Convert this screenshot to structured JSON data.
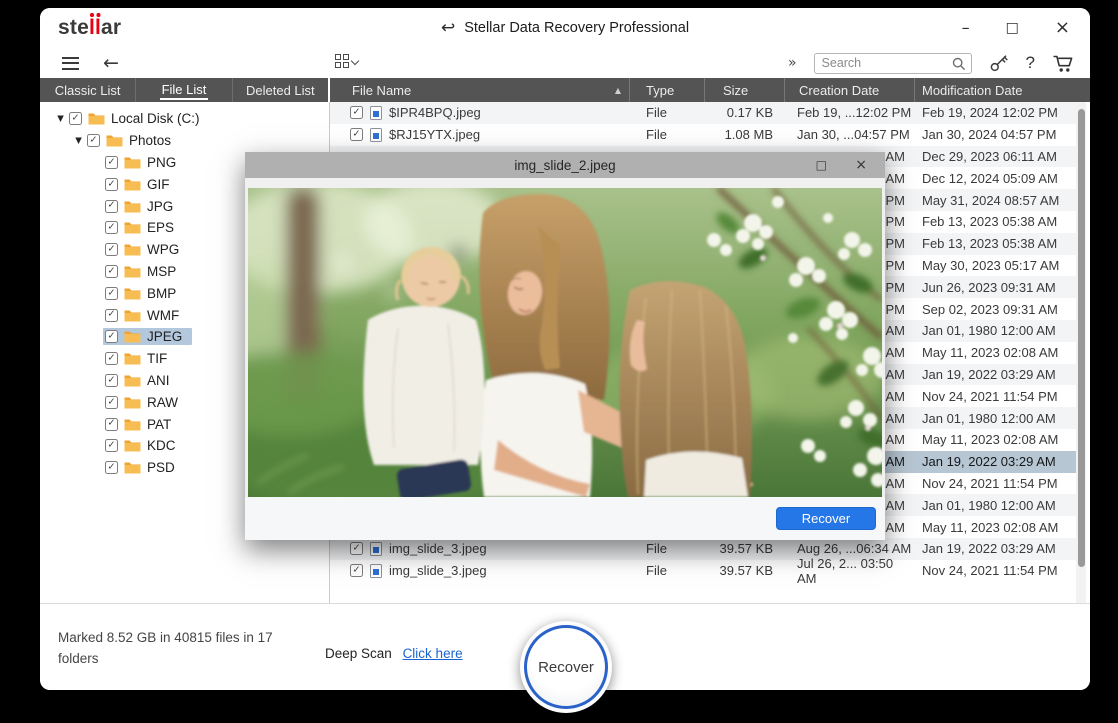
{
  "colors": {
    "accent-red": "#e60012",
    "header-dark": "#545454",
    "selection": "#b7c6d3",
    "tree-selection": "#b3c7dd",
    "link-blue": "#1a63d2",
    "recover-blue": "#2577e8",
    "ring-blue": "#2a62c9"
  },
  "icons": {
    "back_title": "↩",
    "arrow_left": "←",
    "chevrons_right": "»",
    "help": "?",
    "minimize": "–",
    "maximize": "□",
    "close": "×",
    "sort_asc": "▲",
    "expand": "▼",
    "check": "✓"
  },
  "app": {
    "logo_pre": "ste",
    "logo_accent": "ll",
    "logo_post": "ar",
    "title": "Stellar Data Recovery Professional"
  },
  "toolbar": {
    "search_placeholder": "Search"
  },
  "sidebar": {
    "tabs": [
      {
        "label": "Classic List",
        "active": false
      },
      {
        "label": "File List",
        "active": true
      },
      {
        "label": "Deleted List",
        "active": false
      }
    ],
    "tree": [
      {
        "label": "Local Disk (C:)",
        "level": 0,
        "expand": true,
        "checked": true,
        "selected": false
      },
      {
        "label": "Photos",
        "level": 1,
        "expand": true,
        "checked": true,
        "selected": false
      },
      {
        "label": "PNG",
        "level": 2,
        "expand": false,
        "checked": true,
        "selected": false
      },
      {
        "label": "GIF",
        "level": 2,
        "expand": false,
        "checked": true,
        "selected": false
      },
      {
        "label": "JPG",
        "level": 2,
        "expand": false,
        "checked": true,
        "selected": false
      },
      {
        "label": "EPS",
        "level": 2,
        "expand": false,
        "checked": true,
        "selected": false
      },
      {
        "label": "WPG",
        "level": 2,
        "expand": false,
        "checked": true,
        "selected": false
      },
      {
        "label": "MSP",
        "level": 2,
        "expand": false,
        "checked": true,
        "selected": false
      },
      {
        "label": "BMP",
        "level": 2,
        "expand": false,
        "checked": true,
        "selected": false
      },
      {
        "label": "WMF",
        "level": 2,
        "expand": false,
        "checked": true,
        "selected": false
      },
      {
        "label": "JPEG",
        "level": 2,
        "expand": false,
        "checked": true,
        "selected": true
      },
      {
        "label": "TIF",
        "level": 2,
        "expand": false,
        "checked": true,
        "selected": false
      },
      {
        "label": "ANI",
        "level": 2,
        "expand": false,
        "checked": true,
        "selected": false
      },
      {
        "label": "RAW",
        "level": 2,
        "expand": false,
        "checked": true,
        "selected": false
      },
      {
        "label": "PAT",
        "level": 2,
        "expand": false,
        "checked": true,
        "selected": false
      },
      {
        "label": "KDC",
        "level": 2,
        "expand": false,
        "checked": true,
        "selected": false
      },
      {
        "label": "PSD",
        "level": 2,
        "expand": false,
        "checked": true,
        "selected": false
      }
    ]
  },
  "table": {
    "columns": [
      "File Name",
      "Type",
      "Size",
      "Creation Date",
      "Modification Date"
    ],
    "rows": [
      {
        "name": "$IPR4BPQ.jpeg",
        "type": "File",
        "size": "0.17 KB",
        "created": "Feb 19, ...12:02 PM",
        "modified": "Feb 19, 2024 12:02 PM",
        "checked": true,
        "covered": false,
        "selected": false
      },
      {
        "name": "$RJ15YTX.jpeg",
        "type": "File",
        "size": "1.08 MB",
        "created": "Jan 30, ...04:57 PM",
        "modified": "Jan 30, 2024 04:57 PM",
        "checked": true,
        "covered": false,
        "selected": false
      },
      {
        "name": "",
        "type": "",
        "size": "",
        "created": "AM",
        "modified": "Dec 29, 2023 06:11 AM",
        "covered": true,
        "selected": false
      },
      {
        "name": "",
        "type": "",
        "size": "",
        "created": "AM",
        "modified": "Dec 12, 2024 05:09 AM",
        "covered": true,
        "selected": false
      },
      {
        "name": "",
        "type": "",
        "size": "",
        "created": "PM",
        "modified": "May 31, 2024 08:57 AM",
        "covered": true,
        "selected": false
      },
      {
        "name": "",
        "type": "",
        "size": "",
        "created": "PM",
        "modified": "Feb 13, 2023 05:38 AM",
        "covered": true,
        "selected": false
      },
      {
        "name": "",
        "type": "",
        "size": "",
        "created": "PM",
        "modified": "Feb 13, 2023 05:38 AM",
        "covered": true,
        "selected": false
      },
      {
        "name": "",
        "type": "",
        "size": "",
        "created": "PM",
        "modified": "May 30, 2023 05:17 AM",
        "covered": true,
        "selected": false
      },
      {
        "name": "",
        "type": "",
        "size": "",
        "created": "PM",
        "modified": "Jun 26, 2023 09:31 AM",
        "covered": true,
        "selected": false
      },
      {
        "name": "",
        "type": "",
        "size": "",
        "created": "PM",
        "modified": "Sep 02, 2023 09:31 AM",
        "covered": true,
        "selected": false
      },
      {
        "name": "",
        "type": "",
        "size": "",
        "created": "AM",
        "modified": "Jan 01, 1980 12:00 AM",
        "covered": true,
        "selected": false
      },
      {
        "name": "",
        "type": "",
        "size": "",
        "created": "AM",
        "modified": "May 11, 2023 02:08 AM",
        "covered": true,
        "selected": false
      },
      {
        "name": "",
        "type": "",
        "size": "",
        "created": "AM",
        "modified": "Jan 19, 2022 03:29 AM",
        "covered": true,
        "selected": false
      },
      {
        "name": "",
        "type": "",
        "size": "",
        "created": "AM",
        "modified": "Nov 24, 2021 11:54 PM",
        "covered": true,
        "selected": false
      },
      {
        "name": "",
        "type": "",
        "size": "",
        "created": "AM",
        "modified": "Jan 01, 1980 12:00 AM",
        "covered": true,
        "selected": false
      },
      {
        "name": "",
        "type": "",
        "size": "",
        "created": "AM",
        "modified": "May 11, 2023 02:08 AM",
        "covered": true,
        "selected": false
      },
      {
        "name": "",
        "type": "",
        "size": "",
        "created": "AM",
        "modified": "Jan 19, 2022 03:29 AM",
        "covered": true,
        "selected": true
      },
      {
        "name": "",
        "type": "",
        "size": "",
        "created": "AM",
        "modified": "Nov 24, 2021 11:54 PM",
        "covered": true,
        "selected": false
      },
      {
        "name": "",
        "type": "",
        "size": "",
        "created": "AM",
        "modified": "Jan 01, 1980 12:00 AM",
        "covered": true,
        "selected": false
      },
      {
        "name": "",
        "type": "",
        "size": "",
        "created": "AM",
        "modified": "May 11, 2023 02:08 AM",
        "covered": true,
        "selected": false
      },
      {
        "name": "img_slide_3.jpeg",
        "type": "File",
        "size": "39.57 KB",
        "created": "Aug 26, ...06:34 AM",
        "modified": "Jan 19, 2022 03:29 AM",
        "checked": true,
        "covered": false,
        "selected": false
      },
      {
        "name": "img_slide_3.jpeg",
        "type": "File",
        "size": "39.57 KB",
        "created": "Jul 26, 2... 03:50 AM",
        "modified": "Nov 24, 2021 11:54 PM",
        "checked": true,
        "covered": false,
        "selected": false
      }
    ]
  },
  "preview": {
    "title": "img_slide_2.jpeg",
    "recover_label": "Recover"
  },
  "statusbar": {
    "marked_text": "Marked 8.52 GB in 40815 files in 17 folders",
    "deep_scan_label": "Deep Scan",
    "deep_scan_link": "Click here",
    "recover_label": "Recover"
  }
}
